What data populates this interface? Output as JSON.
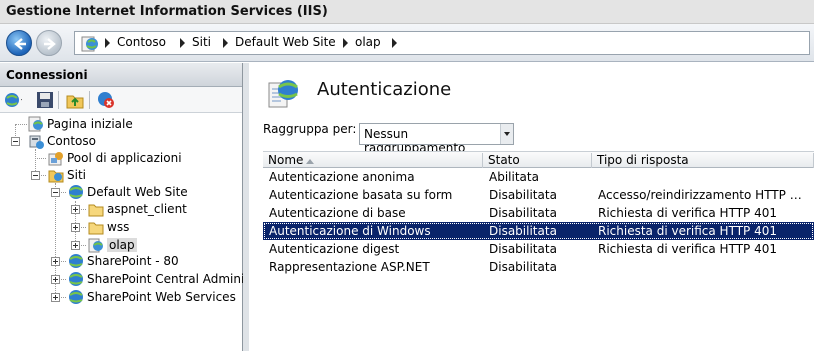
{
  "window": {
    "title": "Gestione Internet Information Services (IIS)"
  },
  "address": {
    "breadcrumbs": [
      "Contoso",
      "Siti",
      "Default Web Site",
      "olap"
    ]
  },
  "connections": {
    "header": "Connessioni",
    "tree": [
      {
        "label": "Pagina iniziale"
      },
      {
        "label": "Contoso"
      },
      {
        "label": "Pool di applicazioni"
      },
      {
        "label": "Siti"
      },
      {
        "label": "Default Web Site"
      },
      {
        "label": "aspnet_client"
      },
      {
        "label": "wss"
      },
      {
        "label": "olap"
      },
      {
        "label": "SharePoint - 80"
      },
      {
        "label": "SharePoint Central Administra"
      },
      {
        "label": "SharePoint Web Services"
      }
    ]
  },
  "feature": {
    "title": "Autenticazione",
    "group_label": "Raggruppa per:",
    "group_value": "Nessun raggruppamento",
    "columns": [
      "Nome",
      "Stato",
      "Tipo di risposta"
    ],
    "rows": [
      {
        "name": "Autenticazione anonima",
        "status": "Abilitata",
        "response": ""
      },
      {
        "name": "Autenticazione basata su form",
        "status": "Disabilitata",
        "response": "Accesso/reindirizzamento HTTP …"
      },
      {
        "name": "Autenticazione di base",
        "status": "Disabilitata",
        "response": "Richiesta di verifica HTTP 401"
      },
      {
        "name": "Autenticazione di Windows",
        "status": "Disabilitata",
        "response": "Richiesta di verifica HTTP 401"
      },
      {
        "name": "Autenticazione digest",
        "status": "Disabilitata",
        "response": "Richiesta di verifica HTTP 401"
      },
      {
        "name": "Rappresentazione ASP.NET",
        "status": "Disabilitata",
        "response": ""
      }
    ],
    "selected_row": 3
  },
  "colors": {
    "selection": "#0a246a",
    "title_bar": "#e4e4e4",
    "pane_header": "#cfd5db"
  }
}
